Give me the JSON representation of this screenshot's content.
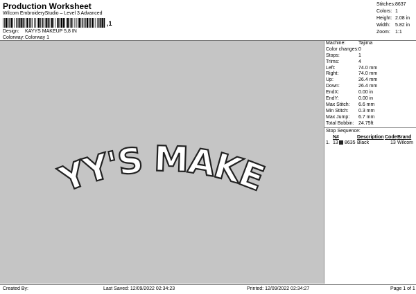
{
  "header": {
    "title": "Production Worksheet",
    "subtitle": "Wilcom EmbroideryStudio – Level 3 Advanced",
    "barcode_suffix": ",1"
  },
  "design_info": {
    "design_label": "Design:",
    "design_value": "KAYYS MAKEUP 5,8 IN",
    "colorway_label": "Colorway:",
    "colorway_value": "Colorway 1"
  },
  "summary": [
    {
      "label": "Stitches:",
      "value": "8637"
    },
    {
      "label": "Colors:",
      "value": "1"
    },
    {
      "label": "Height:",
      "value": "2.08 in"
    },
    {
      "label": "Width:",
      "value": "5.82 in"
    },
    {
      "label": "Zoom:",
      "value": "1:1"
    }
  ],
  "design_text": "KAYY'S MAKEUP",
  "stats": [
    {
      "label": "Machine:",
      "value": "Tajima"
    },
    {
      "label": "Color changes:",
      "value": "0"
    },
    {
      "label": "Stops:",
      "value": "1"
    },
    {
      "label": "Trims:",
      "value": "4"
    },
    {
      "label": "Left:",
      "value": "74.0 mm"
    },
    {
      "label": "Right:",
      "value": "74.0 mm"
    },
    {
      "label": "Up:",
      "value": "26.4 mm"
    },
    {
      "label": "Down:",
      "value": "26.4 mm"
    },
    {
      "label": "EndX:",
      "value": "0.00 in"
    },
    {
      "label": "EndY:",
      "value": "0.00 in"
    },
    {
      "label": "Max Stitch:",
      "value": "6.6 mm"
    },
    {
      "label": "Min Stitch:",
      "value": "0.3 mm"
    },
    {
      "label": "Max Jump:",
      "value": "6.7 mm"
    },
    {
      "label": "Total Bobbin:",
      "value": "24.75ft"
    }
  ],
  "stop_sequence": {
    "title": "Stop Sequence:",
    "headers": {
      "stop": "",
      "n": "N#",
      "description": "Description",
      "code": "Code",
      "brand": "Brand"
    },
    "rows": [
      {
        "stop": "1.",
        "index": "13",
        "n": "8635",
        "description": "Black",
        "code": "13",
        "brand": "Wilcom",
        "color": "#222222"
      }
    ]
  },
  "footer": {
    "created_by": "Created By:",
    "last_saved": "Last Saved: 12/09/2022 02:34:23",
    "printed": "Printed: 12/09/2022 02:34:27",
    "page": "Page 1 of 1"
  }
}
